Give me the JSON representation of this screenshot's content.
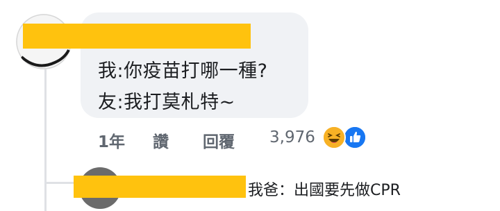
{
  "comment": {
    "lines": [
      "我:你疫苗打哪一種?",
      "友:我打莫札特~"
    ],
    "time_ago": "1年",
    "like_label": "讚",
    "reply_label": "回覆",
    "reaction_count": "3,976",
    "reaction_icons": [
      "haha-icon",
      "like-icon"
    ]
  },
  "reply": {
    "text": "我爸：出國要先做CPR"
  },
  "colors": {
    "bubble": "#f0f2f5",
    "redaction": "#ffc20e",
    "meta_text": "#606770",
    "like_blue": "#1877f2",
    "haha_yellow": "#f7b125"
  }
}
